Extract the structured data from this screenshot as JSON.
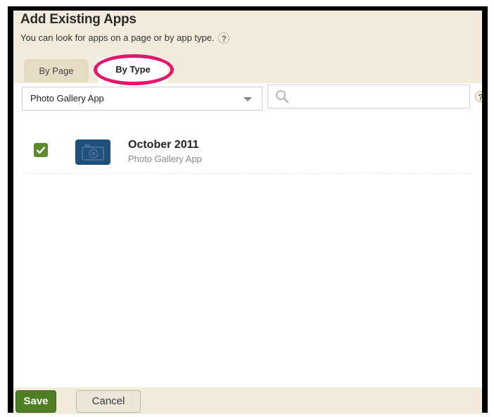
{
  "dialog": {
    "title": "Add Existing Apps",
    "subtitle": "You can look for apps on a page or by app type.",
    "help_glyph": "?"
  },
  "tabs": [
    {
      "label": "By Page",
      "active": false
    },
    {
      "label": "By Type",
      "active": true
    }
  ],
  "filter": {
    "selected_type": "Photo Gallery App",
    "search_value": "",
    "search_icon": "search-icon"
  },
  "items": [
    {
      "checked": true,
      "icon": "camera-icon",
      "title": "October 2011",
      "subtitle": "Photo Gallery App"
    }
  ],
  "footer": {
    "save_label": "Save",
    "cancel_label": "Cancel"
  },
  "colors": {
    "header_bg": "#f3ecdc",
    "highlight": "#e4166c",
    "save_green": "#4e7f22",
    "app_icon_blue": "#1f4f7a"
  }
}
